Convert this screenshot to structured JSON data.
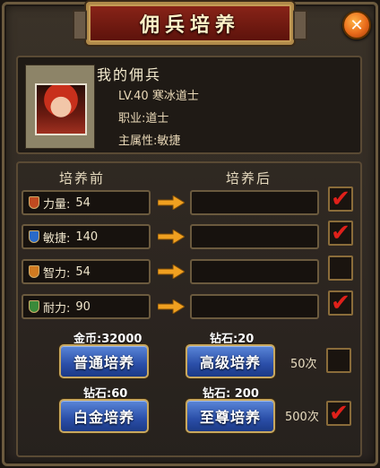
{
  "title": "佣兵培养",
  "close_icon": "close-icon",
  "mercenary": {
    "name": "我的佣兵",
    "level_class": "LV.40 寒冰道士",
    "profession": "职业:道士",
    "main_attr": "主属性:敏捷"
  },
  "columns": {
    "before": "培养前",
    "after": "培养后"
  },
  "stats": [
    {
      "label": "力量:",
      "value": "54",
      "icon_color": "#c04a20",
      "checked": true
    },
    {
      "label": "敏捷:",
      "value": "140",
      "icon_color": "#2a6ac8",
      "checked": true
    },
    {
      "label": "智力:",
      "value": "54",
      "icon_color": "#d07a20",
      "checked": false
    },
    {
      "label": "耐力:",
      "value": "90",
      "icon_color": "#3a8a3a",
      "checked": true
    }
  ],
  "options": [
    {
      "cost": "金币:32000",
      "button": "普通培养"
    },
    {
      "cost": "钻石:20",
      "button": "高级培养"
    },
    {
      "cost": "钻石:60",
      "button": "白金培养"
    },
    {
      "cost": "钻石: 200",
      "button": "至尊培养"
    }
  ],
  "batch": [
    {
      "label": "50次",
      "checked": false
    },
    {
      "label": "500次",
      "checked": true
    }
  ],
  "check_mark": "✔",
  "colors": {
    "accent": "#f0a020",
    "check": "#e0201a",
    "button": "#2a4ea8"
  }
}
